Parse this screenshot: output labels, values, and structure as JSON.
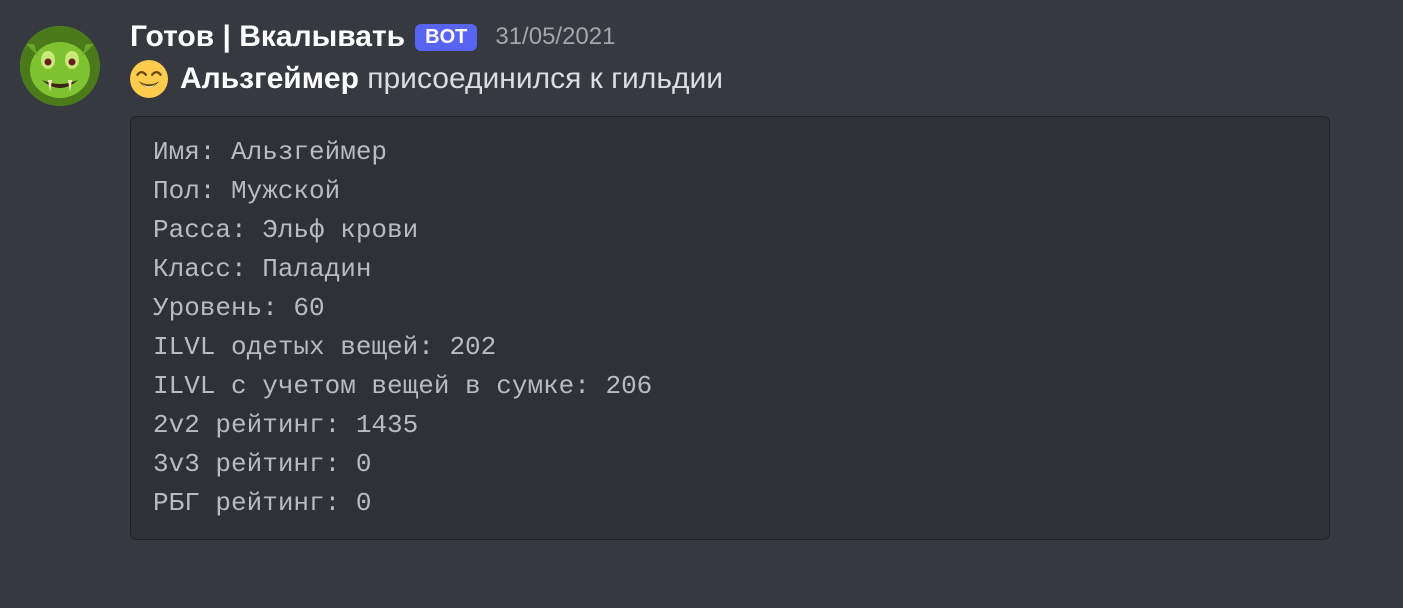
{
  "author": {
    "name": "Готов | Вкалывать",
    "bot_tag": "BOT",
    "timestamp": "31/05/2021"
  },
  "message": {
    "emoji": "😄",
    "subject": "Альзгеймер",
    "action": "присоединился к гильдии"
  },
  "stats": {
    "lines": [
      "Имя: Альзгеймер",
      "Пол: Мужской",
      "Расса: Эльф крови",
      "Класс: Паладин",
      "Уровень: 60",
      "ILVL одетых вещей: 202",
      "ILVL с учетом вещей в сумке: 206",
      "2v2 рейтинг: 1435",
      "3v3 рейтинг: 0",
      "РБГ рейтинг: 0"
    ]
  }
}
